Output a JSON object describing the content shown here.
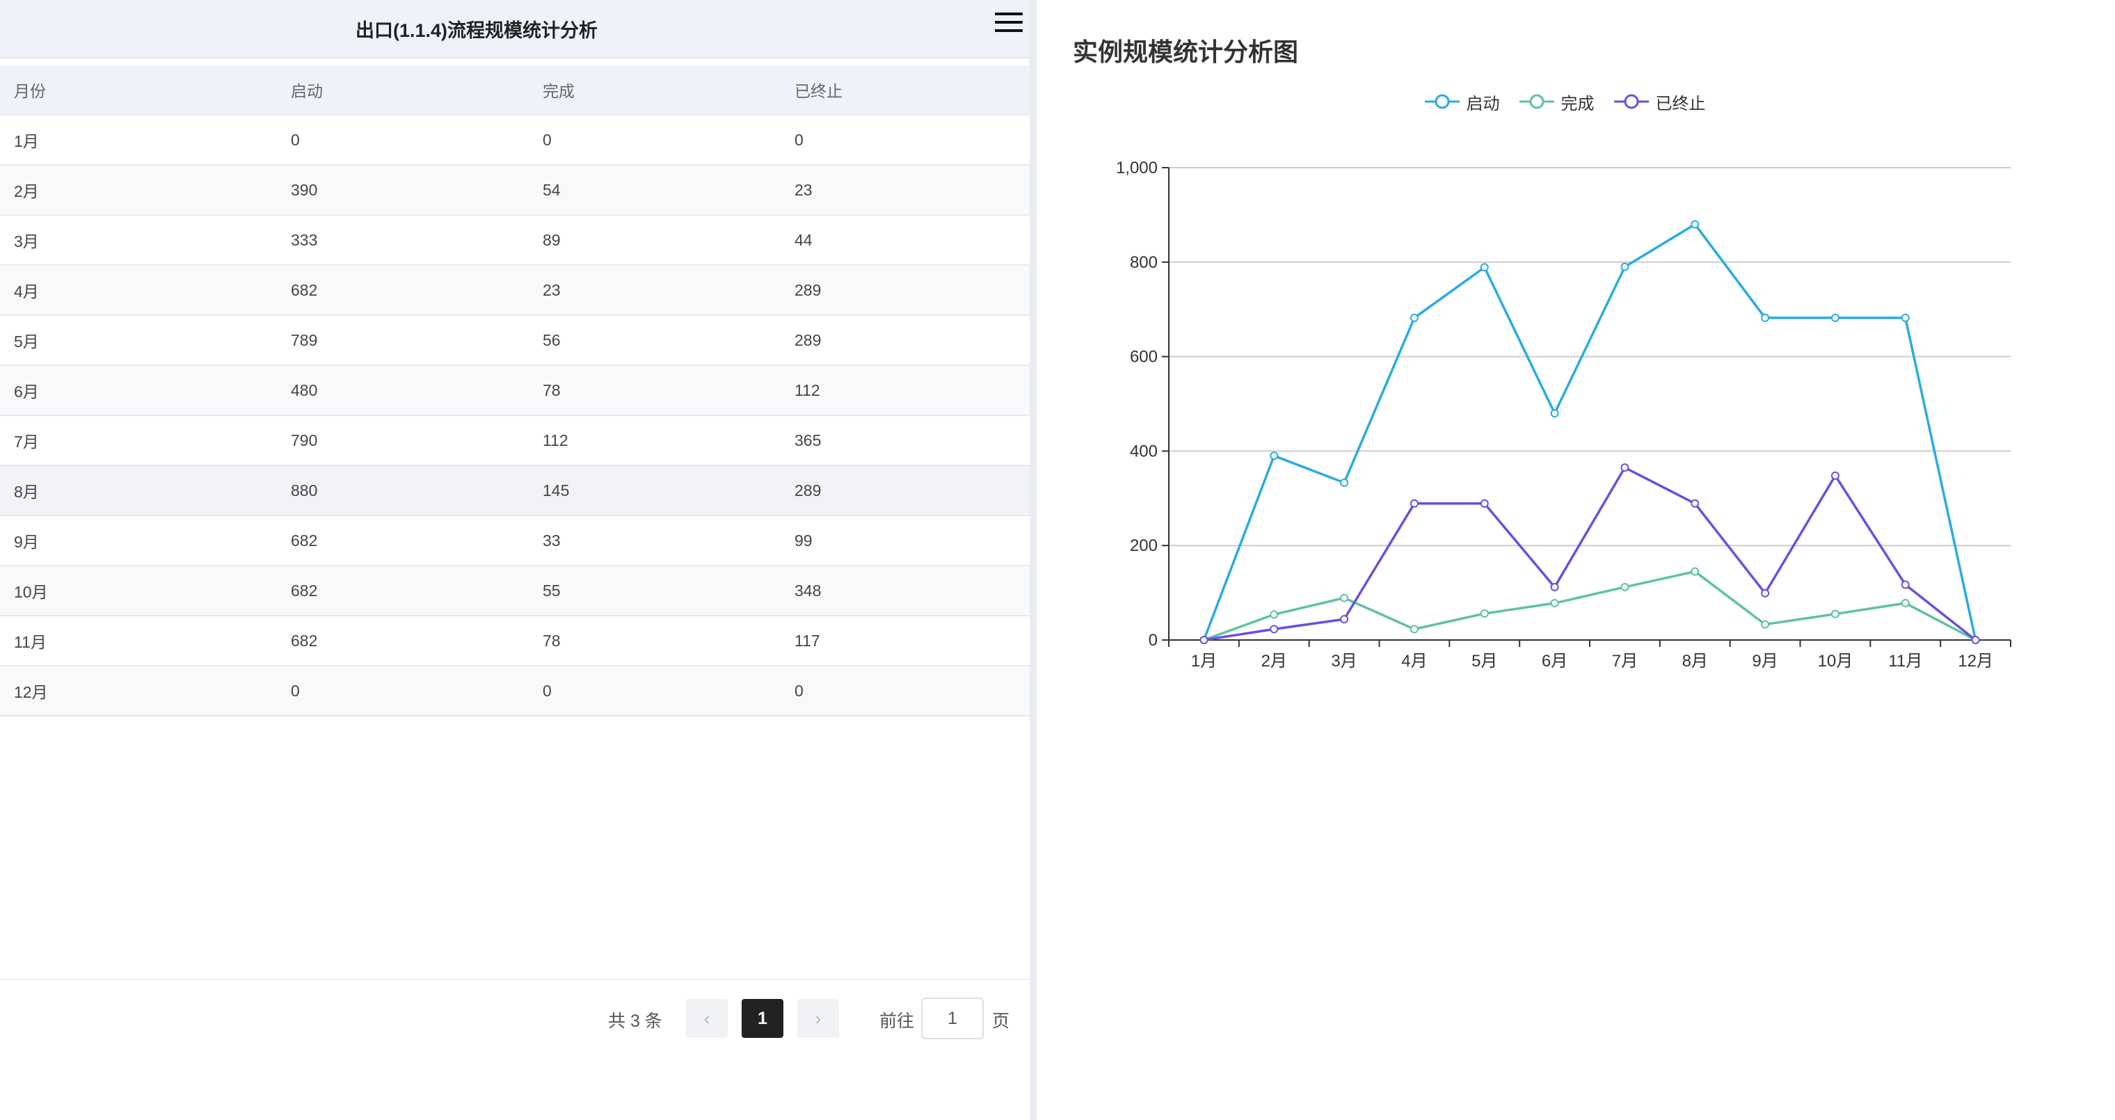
{
  "left_panel": {
    "title": "出口(1.1.4)流程规模统计分析",
    "menu_icon": "hamburger-menu-icon",
    "table": {
      "columns": [
        "月份",
        "启动",
        "完成",
        "已终止"
      ],
      "rows": [
        [
          "1月",
          "0",
          "0",
          "0"
        ],
        [
          "2月",
          "390",
          "54",
          "23"
        ],
        [
          "3月",
          "333",
          "89",
          "44"
        ],
        [
          "4月",
          "682",
          "23",
          "289"
        ],
        [
          "5月",
          "789",
          "56",
          "289"
        ],
        [
          "6月",
          "480",
          "78",
          "112"
        ],
        [
          "7月",
          "790",
          "112",
          "365"
        ],
        [
          "8月",
          "880",
          "145",
          "289"
        ],
        [
          "9月",
          "682",
          "33",
          "99"
        ],
        [
          "10月",
          "682",
          "55",
          "348"
        ],
        [
          "11月",
          "682",
          "78",
          "117"
        ],
        [
          "12月",
          "0",
          "0",
          "0"
        ]
      ]
    },
    "pagination": {
      "total_text": "共 3 条",
      "prev_icon": "chevron-left-icon",
      "next_icon": "chevron-right-icon",
      "current_page": "1",
      "goto_label": "前往",
      "goto_value": "1",
      "page_unit": "页"
    }
  },
  "right_panel": {
    "title": "实例规模统计分析图"
  },
  "chart_data": {
    "type": "line",
    "title": "实例规模统计分析图",
    "categories": [
      "1月",
      "2月",
      "3月",
      "4月",
      "5月",
      "6月",
      "7月",
      "8月",
      "9月",
      "10月",
      "11月",
      "12月"
    ],
    "series": [
      {
        "name": "启动",
        "color": "#29abe2",
        "values": [
          0,
          390,
          333,
          682,
          789,
          480,
          790,
          880,
          682,
          682,
          682,
          0
        ]
      },
      {
        "name": "完成",
        "color": "#5ec2a0",
        "values": [
          0,
          54,
          89,
          23,
          56,
          78,
          112,
          145,
          33,
          55,
          78,
          0
        ]
      },
      {
        "name": "已终止",
        "color": "#6a4fe0",
        "values": [
          0,
          23,
          44,
          289,
          289,
          112,
          365,
          289,
          99,
          348,
          117,
          0
        ]
      }
    ],
    "ylim": [
      0,
      1000
    ],
    "yticks": [
      "0",
      "200",
      "400",
      "600",
      "800",
      "1,000"
    ],
    "grid": true,
    "legend": "top-center"
  },
  "colors": {
    "header_bg": "#eef3fa",
    "accent_dark": "#222222"
  }
}
